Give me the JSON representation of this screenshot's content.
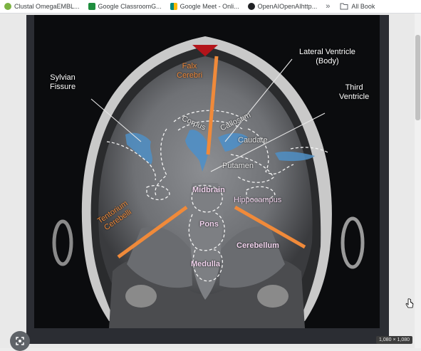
{
  "bookmarks": [
    {
      "label": "Clustal OmegaEMBL...",
      "icon": "clustal-icon",
      "color": "#7cb342"
    },
    {
      "label": "Google ClassroomG...",
      "icon": "classroom-icon",
      "color": "#1e8e3e"
    },
    {
      "label": "Google Meet - Onli...",
      "icon": "meet-icon",
      "color": "#00897b"
    },
    {
      "label": "OpenAIOpenAIhttp...",
      "icon": "openai-icon",
      "color": "#202124"
    }
  ],
  "overflow_label": "»",
  "all_bookmarks_label": "All Book",
  "image": {
    "dimensions_label": "1,080 × 1,080",
    "labels": {
      "lateral_ventricle": "Lateral Ventricle",
      "lateral_ventricle_sub": "(Body)",
      "third_ventricle_1": "Third",
      "third_ventricle_2": "Ventricle",
      "sylvian_1": "Sylvian",
      "sylvian_2": "Fissure",
      "falx_1": "Falx",
      "falx_2": "Cerebri",
      "corpus": "Corpus",
      "callosum": "Callosum",
      "caudate": "Caudate",
      "putamen": "Putamen",
      "midbrain": "Midbrain",
      "hippocampus": "Hippocampus",
      "tentorium_1": "Tentorium",
      "tentorium_2": "Cerebelli",
      "pons": "Pons",
      "cerebellum": "Cerebellum",
      "medulla": "Medulla"
    }
  },
  "colors": {
    "orange_accent": "#f08a3a",
    "ventricle_blue": "#4f8fc6",
    "falx_red": "#b3141a"
  }
}
